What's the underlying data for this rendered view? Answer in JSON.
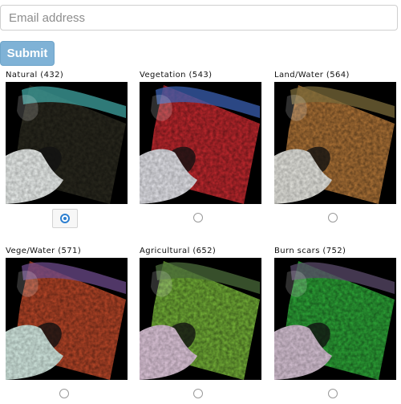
{
  "form": {
    "email_placeholder": "Email address",
    "submit_label": "Submit"
  },
  "options": [
    {
      "label": "Natural (432)",
      "land": "#2b2a1f",
      "snow": "#eef2f0",
      "edge": "#3fa3a0",
      "checked": true
    },
    {
      "label": "Vegetation (543)",
      "land": "#cc2a30",
      "snow": "#e6e6ec",
      "edge": "#3a5fb0",
      "checked": false
    },
    {
      "label": "Land/Water (564)",
      "land": "#b87a3a",
      "snow": "#e8e8e2",
      "edge": "#7a6a3a",
      "checked": false
    },
    {
      "label": "Vege/Water (571)",
      "land": "#c24a2a",
      "snow": "#d6ece4",
      "edge": "#6b4a8a",
      "checked": false
    },
    {
      "label": "Agricultural (652)",
      "land": "#7aba3a",
      "snow": "#e0c8dc",
      "edge": "#4a6a3a",
      "checked": false
    },
    {
      "label": "Burn scars (752)",
      "land": "#2fae3a",
      "snow": "#d8c4d6",
      "edge": "#5a4a6a",
      "checked": false
    }
  ]
}
